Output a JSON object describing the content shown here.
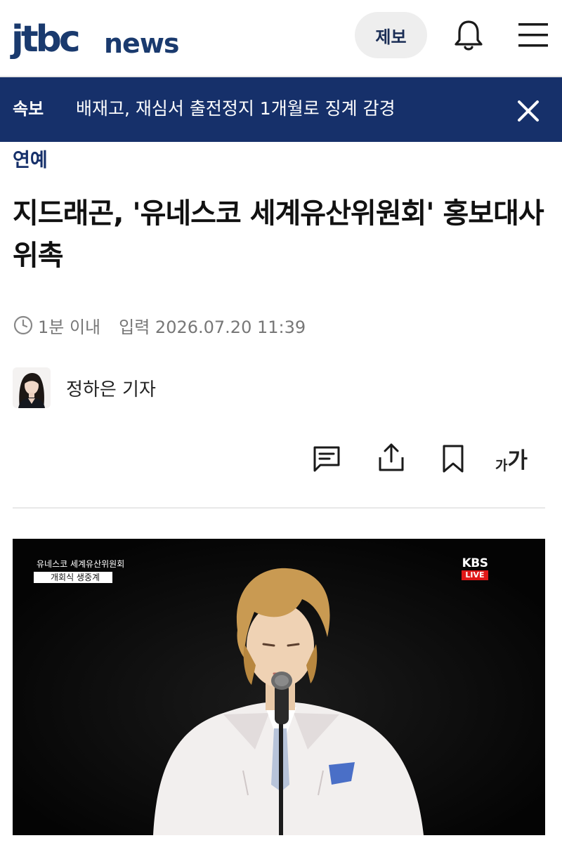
{
  "header": {
    "logo_brand": "jtbc",
    "logo_suffix": "news",
    "tip_button": "제보",
    "icons": [
      "bell-icon",
      "hamburger-menu-icon"
    ],
    "brand_color": "#1a3a6e"
  },
  "breaking": {
    "tag": "속보",
    "text": "배재고, 재심서 출전정지 1개월로 징계 감경",
    "background": "#16306a",
    "close_icon": "close-icon"
  },
  "article": {
    "category": "연예",
    "headline": "지드래곤, '유네스코 세계유산위원회' 홍보대사 위촉",
    "read_time": "1분 이내",
    "published": "입력 2026.07.20 11:39",
    "author": "정하은 기자"
  },
  "toolbar": {
    "icons": [
      "comment-icon",
      "share-icon",
      "bookmark-icon"
    ],
    "font_small": "가",
    "font_large": "가"
  },
  "photo": {
    "caption_line1": "유네스코 세계유산위원회",
    "caption_line2": "개회식 생중계",
    "broadcaster": "KBS",
    "live_badge": "LIVE"
  }
}
